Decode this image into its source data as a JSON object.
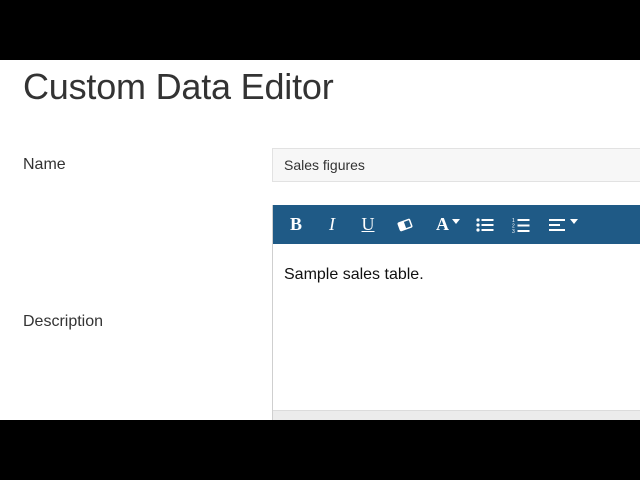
{
  "page": {
    "title": "Custom Data Editor"
  },
  "form": {
    "name_label": "Name",
    "name_value": "Sales figures",
    "description_label": "Description"
  },
  "editor": {
    "content": "Sample sales table.",
    "toolbar": {
      "bold": "B",
      "italic": "I",
      "underline": "U",
      "font": "A",
      "icons": [
        "bold-icon",
        "italic-icon",
        "underline-icon",
        "eraser-icon",
        "font-color-icon",
        "bulleted-list-icon",
        "numbered-list-icon",
        "align-icon"
      ]
    },
    "toolbar_color": "#1f5a86"
  }
}
